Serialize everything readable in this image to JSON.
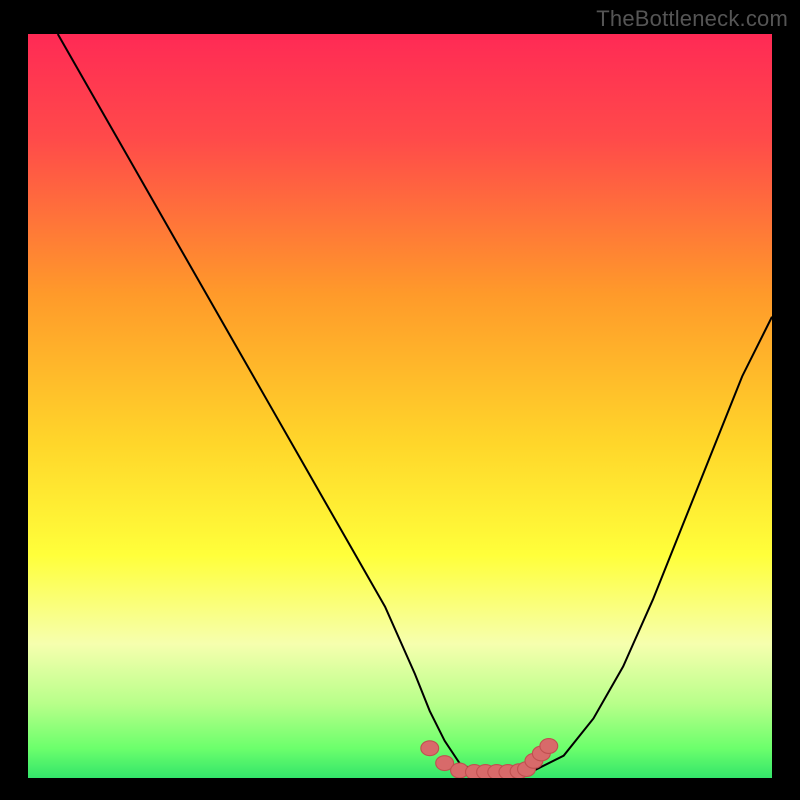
{
  "watermark": "TheBottleneck.com",
  "colors": {
    "background": "#000000",
    "watermark_text": "#555555",
    "curve": "#000000",
    "marker_fill": "#d86a6a",
    "marker_stroke": "#c05050",
    "gradient_stops": [
      {
        "offset": "0%",
        "color": "#ff2a55"
      },
      {
        "offset": "14%",
        "color": "#ff4a4a"
      },
      {
        "offset": "35%",
        "color": "#ff9a2a"
      },
      {
        "offset": "55%",
        "color": "#ffd62a"
      },
      {
        "offset": "70%",
        "color": "#ffff3a"
      },
      {
        "offset": "82%",
        "color": "#f6ffae"
      },
      {
        "offset": "90%",
        "color": "#b8ff8a"
      },
      {
        "offset": "96%",
        "color": "#6cff6c"
      },
      {
        "offset": "100%",
        "color": "#33e56a"
      }
    ]
  },
  "chart_data": {
    "type": "line",
    "title": "",
    "xlabel": "",
    "ylabel": "",
    "xlim": [
      0,
      100
    ],
    "ylim": [
      0,
      100
    ],
    "series": [
      {
        "name": "bottleneck-curve",
        "x": [
          4,
          8,
          12,
          16,
          20,
          24,
          28,
          32,
          36,
          40,
          44,
          48,
          52,
          54,
          56,
          58,
          60,
          62,
          64,
          66,
          68,
          72,
          76,
          80,
          84,
          88,
          92,
          96,
          100
        ],
        "y": [
          100,
          93,
          86,
          79,
          72,
          65,
          58,
          51,
          44,
          37,
          30,
          23,
          14,
          9,
          5,
          2,
          1,
          0.5,
          0.5,
          0.5,
          1,
          3,
          8,
          15,
          24,
          34,
          44,
          54,
          62
        ]
      }
    ],
    "markers": {
      "name": "bottom-dots",
      "x": [
        54,
        56,
        58,
        60,
        61.5,
        63,
        64.5,
        66,
        67,
        68,
        69,
        70
      ],
      "y": [
        4,
        2,
        1,
        0.8,
        0.8,
        0.8,
        0.8,
        0.9,
        1.2,
        2.3,
        3.3,
        4.3
      ]
    }
  }
}
